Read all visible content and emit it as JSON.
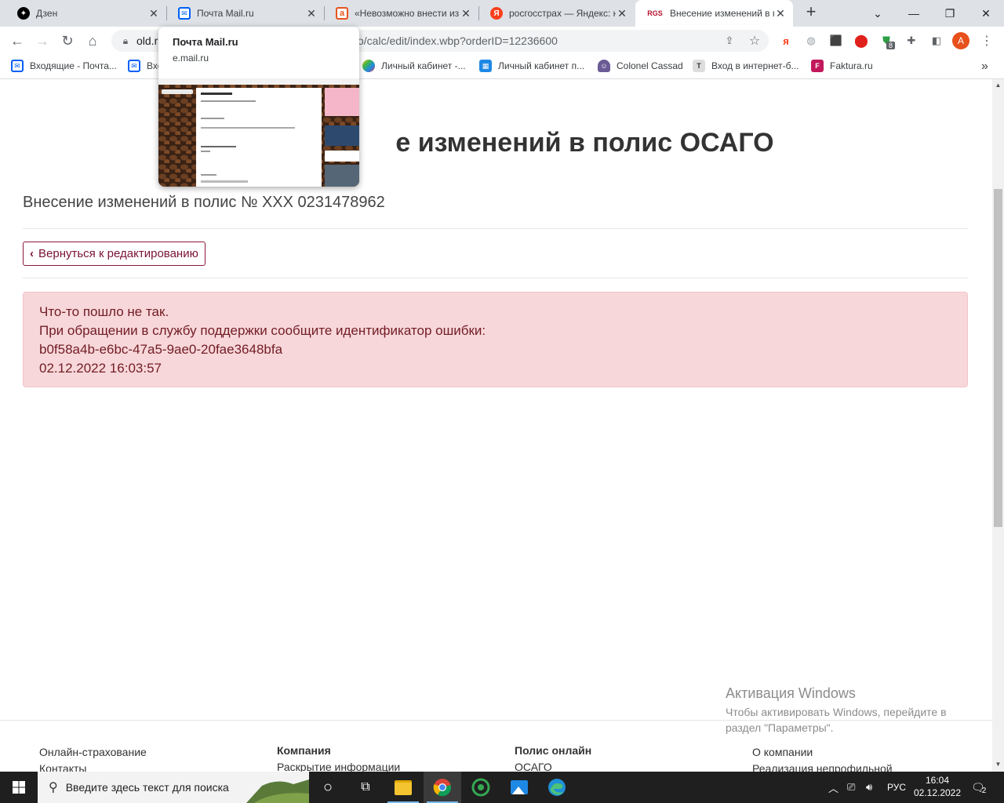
{
  "tabs": [
    {
      "title": "Дзен",
      "active": false
    },
    {
      "title": "Почта Mail.ru",
      "active": false
    },
    {
      "title": "«Невозможно внести из",
      "active": false
    },
    {
      "title": "росгосстрах — Яндекс: н",
      "active": false
    },
    {
      "title": "Внесение изменений в п",
      "active": true
    }
  ],
  "tab_favicon_labels": {
    "rgs": "RGS",
    "yandex": "Я"
  },
  "address_bar": {
    "url_start": "old.r",
    "url_end": "o/calc/edit/index.wbp?orderID=12236600"
  },
  "profile_initial": "A",
  "extension_badge": "8",
  "bookmarks": [
    "Входящие - Почта...",
    "Вхо",
    "Личный кабинет -...",
    "Личный кабинет п...",
    "Colonel Cassad",
    "Вход в интернет-б...",
    "Faktura.ru"
  ],
  "bookmarks_more": "»",
  "hover_card": {
    "title": "Почта Mail.ru",
    "domain": "e.mail.ru"
  },
  "page": {
    "heading_visible": "е изменений в полис ОСАГО",
    "subheading": "Внесение изменений в полис № XXX 0231478962",
    "back_button": "Вернуться к редактированию",
    "alert": {
      "line1": "Что-то пошло не так.",
      "line2": "При обращении в службу поддержки сообщите идентификатор ошибки:",
      "error_id": "b0f58a4b-e6bc-47a5-9ae0-20fae3648bfa",
      "timestamp": "02.12.2022 16:03:57"
    }
  },
  "footer": {
    "col1": [
      "Онлайн-страхование",
      "Контакты"
    ],
    "col2": {
      "heading": "Компания",
      "items": [
        "Раскрытие информации"
      ]
    },
    "col3": {
      "heading": "Полис онлайн",
      "items": [
        "ОСАГО"
      ]
    },
    "col4": [
      "О компании",
      "Реализация непрофильной"
    ]
  },
  "watermark": {
    "title": "Активация Windows",
    "line1": "Чтобы активировать Windows, перейдите в",
    "line2": "раздел \"Параметры\"."
  },
  "taskbar": {
    "search_placeholder": "Введите здесь текст для поиска",
    "language": "РУС",
    "time": "16:04",
    "date": "02.12.2022",
    "notifications": "2"
  },
  "colors": {
    "accent": "#7a1334",
    "alert_bg": "#f7d7da",
    "alert_text": "#721c24"
  }
}
